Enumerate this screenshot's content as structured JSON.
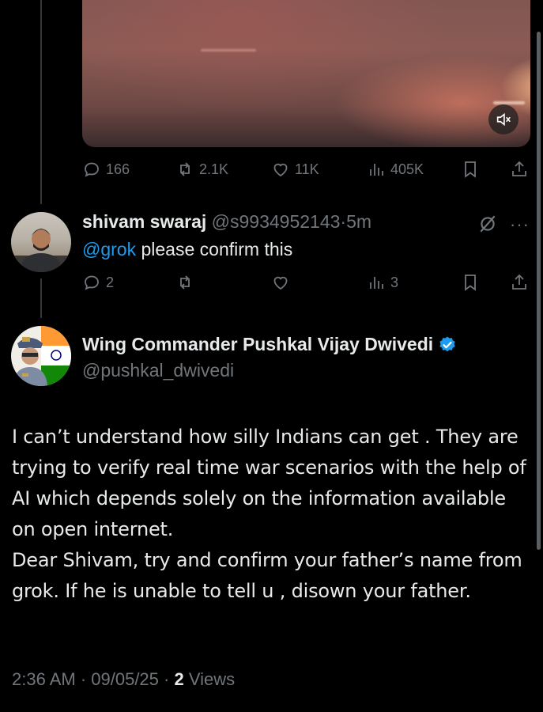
{
  "top_tweet": {
    "actions": {
      "replies": "166",
      "retweets": "2.1K",
      "likes": "11K",
      "views": "405K"
    }
  },
  "reply": {
    "display_name": "shivam swaraj",
    "handle": "@s9934952143",
    "separator": "·",
    "time": "5m",
    "mention": "@grok",
    "text": " please confirm this",
    "actions": {
      "replies": "2",
      "retweets": "",
      "likes": "",
      "views": "3"
    }
  },
  "main_tweet": {
    "display_name": "Wing Commander Pushkal Vijay Dwivedi",
    "handle": "@pushkal_dwivedi",
    "verified": true,
    "body": "I can’t understand how silly Indians can get . They are trying to verify real time war scenarios with the help of AI which depends solely on the information available on open internet.\nDear Shivam, try and confirm your father’s name from grok. If he is unable to tell u , disown your father.",
    "meta_time": "2:36 AM · 09/05/25 · ",
    "meta_views_count": "2",
    "meta_views_label": " Views"
  },
  "colors": {
    "background": "#000000",
    "text": "#e7e9ea",
    "muted": "#71767b",
    "link": "#1d9bf0",
    "verified": "#1d9bf0"
  },
  "icons": [
    "reply-icon",
    "retweet-icon",
    "like-icon",
    "views-icon",
    "bookmark-icon",
    "share-icon",
    "mute-icon",
    "grok-icon",
    "more-icon",
    "verified-badge-icon"
  ]
}
